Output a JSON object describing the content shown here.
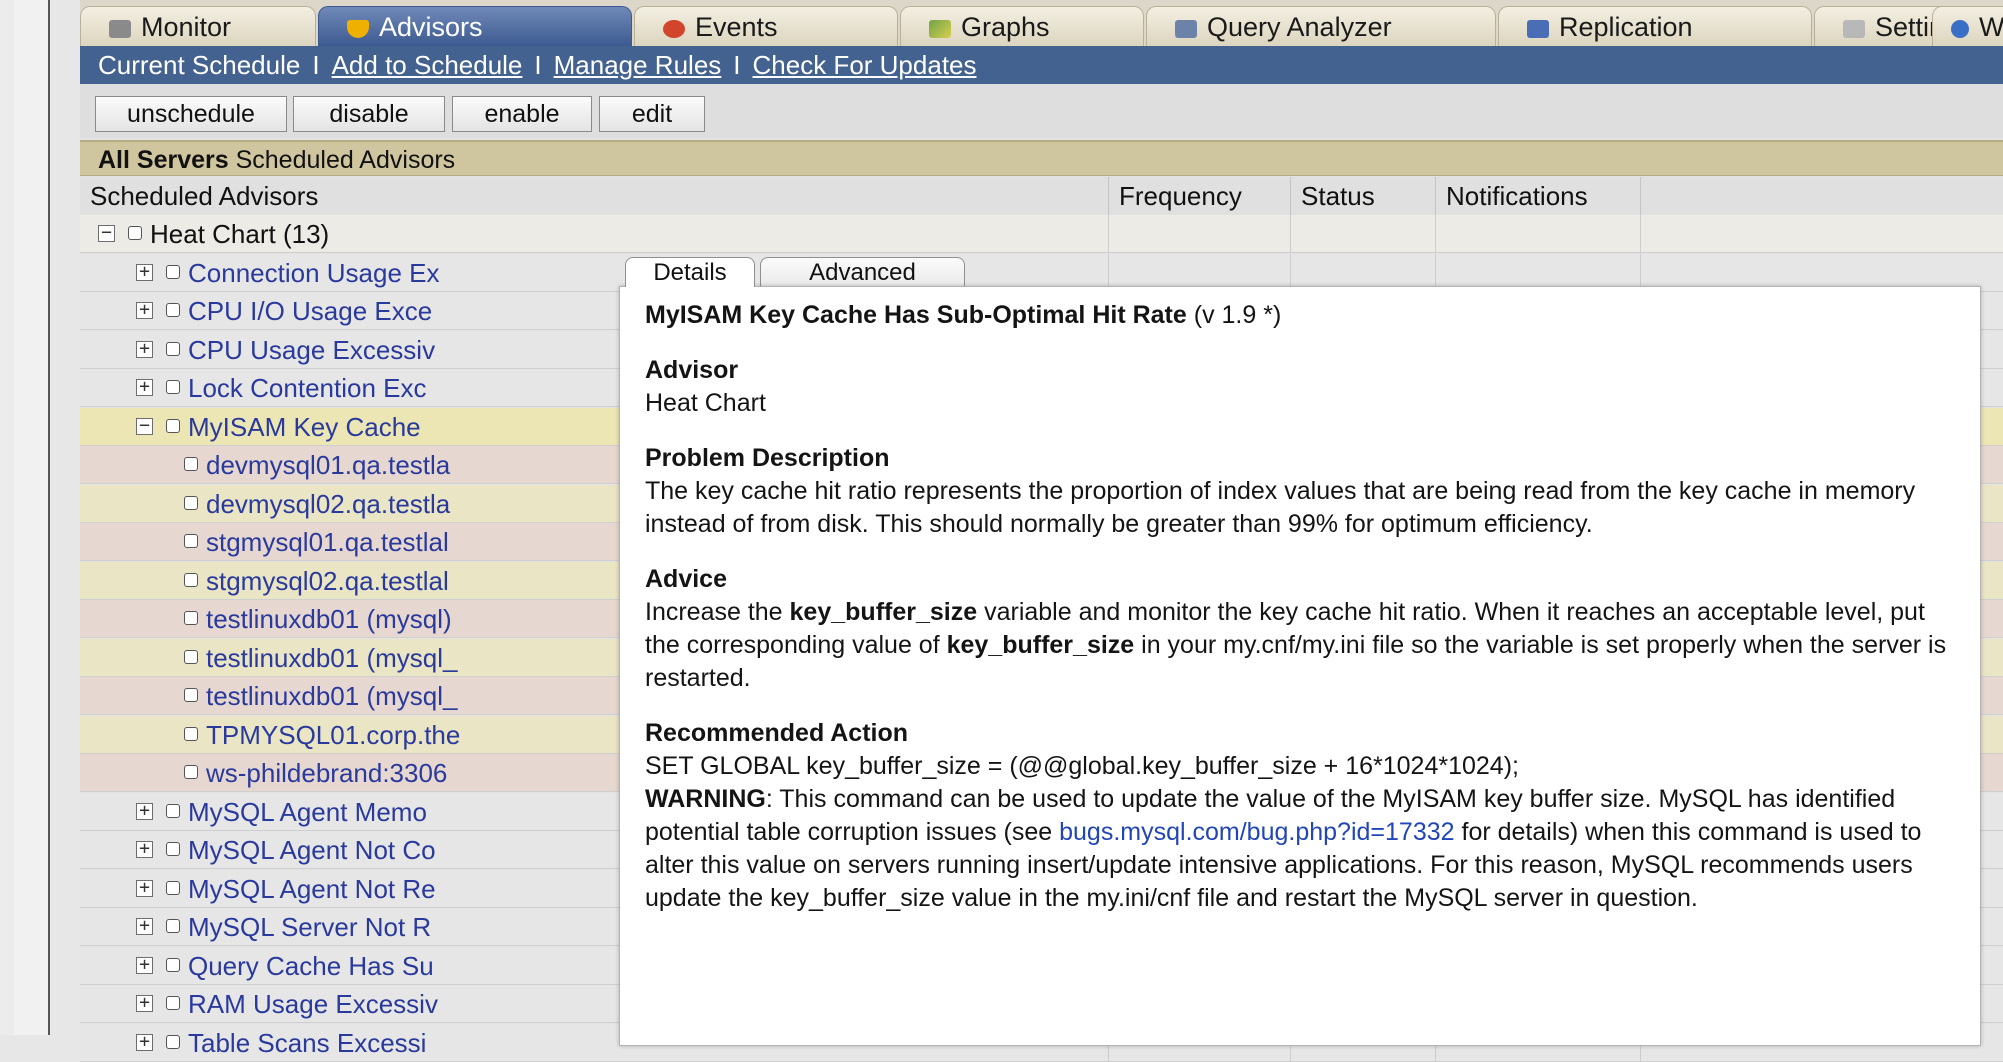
{
  "tabs": [
    {
      "label": "Monitor",
      "icon": "home-icon"
    },
    {
      "label": "Advisors",
      "icon": "shield-icon"
    },
    {
      "label": "Events",
      "icon": "alert-icon"
    },
    {
      "label": "Graphs",
      "icon": "chart-icon"
    },
    {
      "label": "Query Analyzer",
      "icon": "magnifier-icon"
    },
    {
      "label": "Replication",
      "icon": "replication-icon"
    },
    {
      "label": "Settings",
      "icon": "settings-icon"
    },
    {
      "label": "W",
      "icon": "info-icon"
    }
  ],
  "subnav": {
    "current": "Current Schedule",
    "sep": "I",
    "add": "Add to Schedule",
    "manage": "Manage Rules",
    "check": "Check For Updates"
  },
  "toolbar": {
    "unschedule": "unschedule",
    "disable": "disable",
    "enable": "enable",
    "edit": "edit"
  },
  "section": {
    "bold": "All Servers",
    "rest": "Scheduled Advisors"
  },
  "columns": {
    "advisors": "Scheduled Advisors",
    "frequency": "Frequency",
    "status": "Status",
    "notifications": "Notifications"
  },
  "rows": [
    {
      "label": "Heat Chart (13)",
      "level": 0,
      "expander": "−",
      "bg": "#ecebe6",
      "group": true
    },
    {
      "label": "Connection Usage Ex",
      "level": 1,
      "expander": "+",
      "bg": "#e6e6e6"
    },
    {
      "label": "CPU I/O Usage Exce",
      "level": 1,
      "expander": "+",
      "bg": "#e6e6e6"
    },
    {
      "label": "CPU Usage Excessiv",
      "level": 1,
      "expander": "+",
      "bg": "#e6e6e6"
    },
    {
      "label": "Lock Contention Exc",
      "level": 1,
      "expander": "+",
      "bg": "#e6e6e6"
    },
    {
      "label": "MyISAM Key Cache",
      "level": 1,
      "expander": "−",
      "bg": "#ece6b4"
    },
    {
      "label": "devmysql01.qa.testla",
      "level": 2,
      "expander": "",
      "bg": "#e6d8d1"
    },
    {
      "label": "devmysql02.qa.testla",
      "level": 2,
      "expander": "",
      "bg": "#e9e5c5"
    },
    {
      "label": "stgmysql01.qa.testlal",
      "level": 2,
      "expander": "",
      "bg": "#e6d8d1"
    },
    {
      "label": "stgmysql02.qa.testlal",
      "level": 2,
      "expander": "",
      "bg": "#e9e5c5"
    },
    {
      "label": "testlinuxdb01 (mysql)",
      "level": 2,
      "expander": "",
      "bg": "#e6d8d1"
    },
    {
      "label": "testlinuxdb01 (mysql_",
      "level": 2,
      "expander": "",
      "bg": "#e9e5c5"
    },
    {
      "label": "testlinuxdb01 (mysql_",
      "level": 2,
      "expander": "",
      "bg": "#e6d8d1"
    },
    {
      "label": "TPMYSQL01.corp.the",
      "level": 2,
      "expander": "",
      "bg": "#e9e5c5"
    },
    {
      "label": "ws-phildebrand:3306",
      "level": 2,
      "expander": "",
      "bg": "#e6d8d1"
    },
    {
      "label": "MySQL Agent Memo",
      "level": 1,
      "expander": "+",
      "bg": "#e6e6e6"
    },
    {
      "label": "MySQL Agent Not Co",
      "level": 1,
      "expander": "+",
      "bg": "#e6e6e6"
    },
    {
      "label": "MySQL Agent Not Re",
      "level": 1,
      "expander": "+",
      "bg": "#e6e6e6"
    },
    {
      "label": "MySQL Server Not R",
      "level": 1,
      "expander": "+",
      "bg": "#e6e6e6"
    },
    {
      "label": "Query Cache Has Su",
      "level": 1,
      "expander": "+",
      "bg": "#e6e6e6"
    },
    {
      "label": "RAM Usage Excessiv",
      "level": 1,
      "expander": "+",
      "bg": "#e6e6e6"
    },
    {
      "label": "Table Scans Excessi",
      "level": 1,
      "expander": "+",
      "bg": "#e6e6e6"
    }
  ],
  "popup": {
    "tab_details": "Details",
    "tab_advanced": "Advanced",
    "title": "MyISAM Key Cache Has Sub-Optimal Hit Rate",
    "version": "(v 1.9 *)",
    "advisor_heading": "Advisor",
    "advisor_value": "Heat Chart",
    "problem_heading": "Problem Description",
    "problem_text": "The key cache hit ratio represents the proportion of index values that are being read from the key cache in memory instead of from disk. This should normally be greater than 99% for optimum efficiency.",
    "advice_heading": "Advice",
    "advice_1": "Increase the ",
    "advice_kw1": "key_buffer_size",
    "advice_2": " variable and monitor the key cache hit ratio. When it reaches an acceptable level, put the corresponding value of ",
    "advice_kw2": "key_buffer_size",
    "advice_3": " in your my.cnf/my.ini file so the variable is set properly when the server is restarted.",
    "action_heading": "Recommended Action",
    "action_sql": "SET GLOBAL key_buffer_size = (@@global.key_buffer_size + 16*1024*1024);",
    "warning_label": "WARNING",
    "warning_1": ": This command can be used to update the value of the MyISAM key buffer size. MySQL has identified potential table corruption issues (see ",
    "warning_link": "bugs.mysql.com/bug.php?id=17332",
    "warning_2": " for details) when this command is used to alter this value on servers running insert/update intensive applications. For this reason, MySQL recommends users update the key_buffer_size value in the my.ini/cnf file and restart the MySQL server in question."
  },
  "colors": {
    "tab_active": "#3d5a90",
    "subnav_bg": "#44628f",
    "section_bg": "#cfc59e",
    "link": "#2246b8",
    "tree_link": "#2a3a9c"
  }
}
